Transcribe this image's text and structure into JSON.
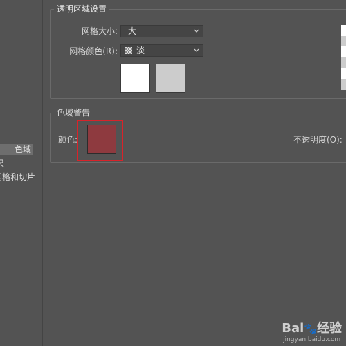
{
  "sidebar": {
    "items": [
      {
        "label": "色域"
      },
      {
        "label": "尺"
      },
      {
        "label": "网格和切片"
      }
    ]
  },
  "transparency": {
    "title": "透明区域设置",
    "grid_size_label": "网格大小:",
    "grid_size_value": "大",
    "grid_color_label": "网格颜色(R):",
    "grid_color_value": "淡",
    "swatch_light": "#ffffff",
    "swatch_dark": "#cccccc"
  },
  "gamut": {
    "title": "色域警告",
    "color_label": "颜色:",
    "color_value": "#8e3a3f",
    "opacity_label": "不透明度(O):"
  },
  "watermark": {
    "logo": "Bai",
    "logo_suffix": "经验",
    "url": "jingyan.baidu.com"
  },
  "colors": {
    "highlight": "#d9232a",
    "background": "#535353"
  }
}
